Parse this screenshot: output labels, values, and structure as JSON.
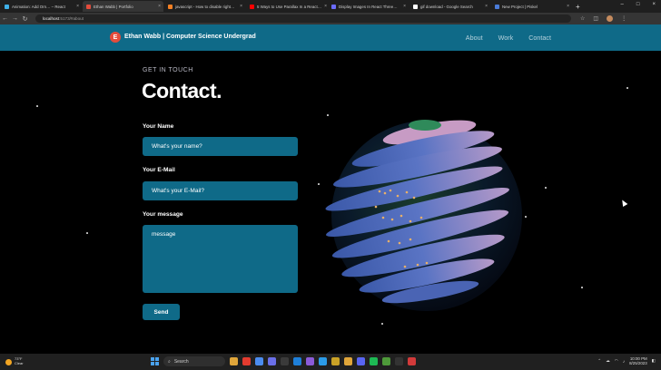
{
  "browser": {
    "tabs": [
      {
        "label": "Animation: Add Orn… – React",
        "color": "#3fb0e8",
        "active": false
      },
      {
        "label": "Ethan Wabb | Portfolio",
        "color": "#e44c3c",
        "active": true
      },
      {
        "label": "javascript - How to disable right…",
        "color": "#f48024",
        "active": false
      },
      {
        "label": "5 Ways to Use Parallax In a React…",
        "color": "#ff0000",
        "active": false
      },
      {
        "label": "Display Images In React Three…",
        "color": "#6c6cff",
        "active": false
      },
      {
        "label": "gif download - Google Search",
        "color": "#ffffff",
        "active": false
      },
      {
        "label": "New Project | Piskel",
        "color": "#4a7bd8",
        "active": false
      }
    ],
    "url_host": "localhost",
    "url_path": ":5173/#about",
    "new_tab_symbol": "+"
  },
  "site": {
    "logo_letter": "E",
    "brand": "Ethan Wabb | Computer Science Undergrad",
    "nav": [
      "About",
      "Work",
      "Contact"
    ]
  },
  "contact": {
    "subtitle": "GET IN TOUCH",
    "title": "Contact.",
    "name_label": "Your Name",
    "name_placeholder": "What's your name?",
    "email_label": "Your E-Mail",
    "email_placeholder": "What's your E-Mail?",
    "message_label": "Your message",
    "message_placeholder": "message",
    "send_label": "Send"
  },
  "taskbar": {
    "weather_temp": "73°F",
    "weather_desc": "Clear",
    "search_placeholder": "Search",
    "time": "10:00 PM",
    "date": "8/25/2023"
  }
}
